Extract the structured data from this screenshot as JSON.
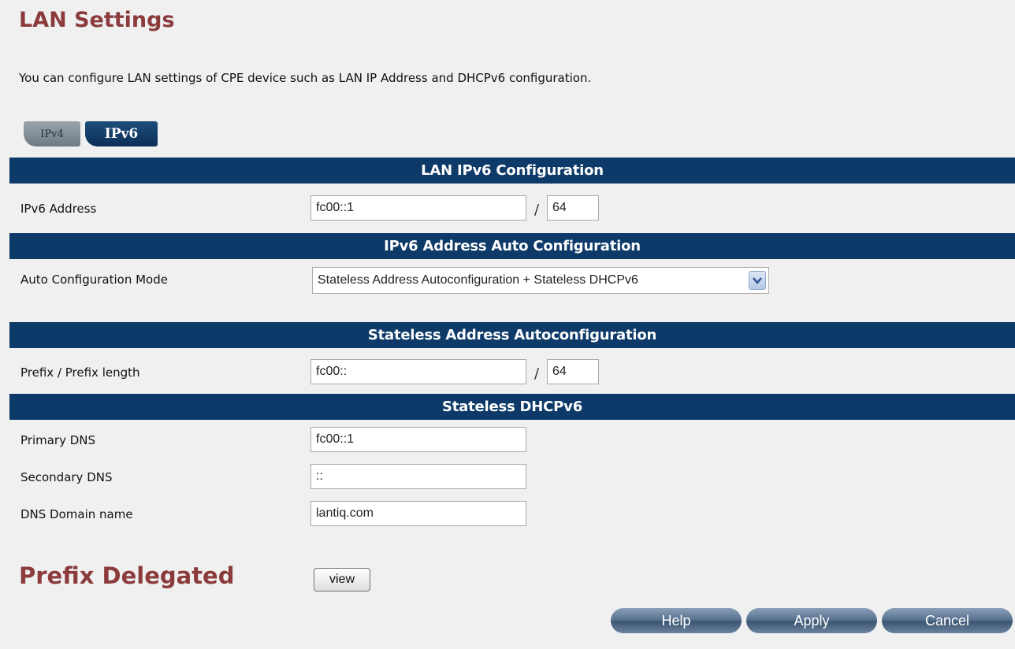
{
  "header": {
    "title": "LAN Settings",
    "description": "You can configure LAN settings of CPE device such as LAN IP Address and DHCPv6 configuration."
  },
  "tabs": [
    {
      "label": "IPv4",
      "active": false
    },
    {
      "label": "IPv6",
      "active": true
    }
  ],
  "sections": {
    "lan_ipv6": {
      "title": "LAN IPv6 Configuration",
      "ipv6_address_label": "IPv6 Address",
      "ipv6_address_value": "fc00::1",
      "prefix_len_value": "64"
    },
    "auto_config": {
      "title": "IPv6 Address Auto Configuration",
      "mode_label": "Auto Configuration Mode",
      "mode_value": "Stateless Address Autoconfiguration + Stateless DHCPv6"
    },
    "slaac": {
      "title": "Stateless Address Autoconfiguration",
      "prefix_label": "Prefix / Prefix length",
      "prefix_value": "fc00::",
      "prefix_len_value": "64"
    },
    "dhcpv6": {
      "title": "Stateless DHCPv6",
      "primary_dns_label": "Primary DNS",
      "primary_dns_value": "fc00::1",
      "secondary_dns_label": "Secondary DNS",
      "secondary_dns_value": "::",
      "domain_label": "DNS Domain name",
      "domain_value": "lantiq.com"
    }
  },
  "prefix_delegated": {
    "title": "Prefix Delegated",
    "view_label": "view"
  },
  "actions": {
    "help": "Help",
    "apply": "Apply",
    "cancel": "Cancel"
  },
  "slash": "/",
  "icons": {
    "select_arrow": "chevron-down-icon"
  },
  "colors": {
    "title": "#8b3b3b",
    "section_header": "#0d3a68",
    "active_tab": "#0b2f57",
    "inactive_tab": "#7d8891",
    "background": "#f0f0f0"
  }
}
